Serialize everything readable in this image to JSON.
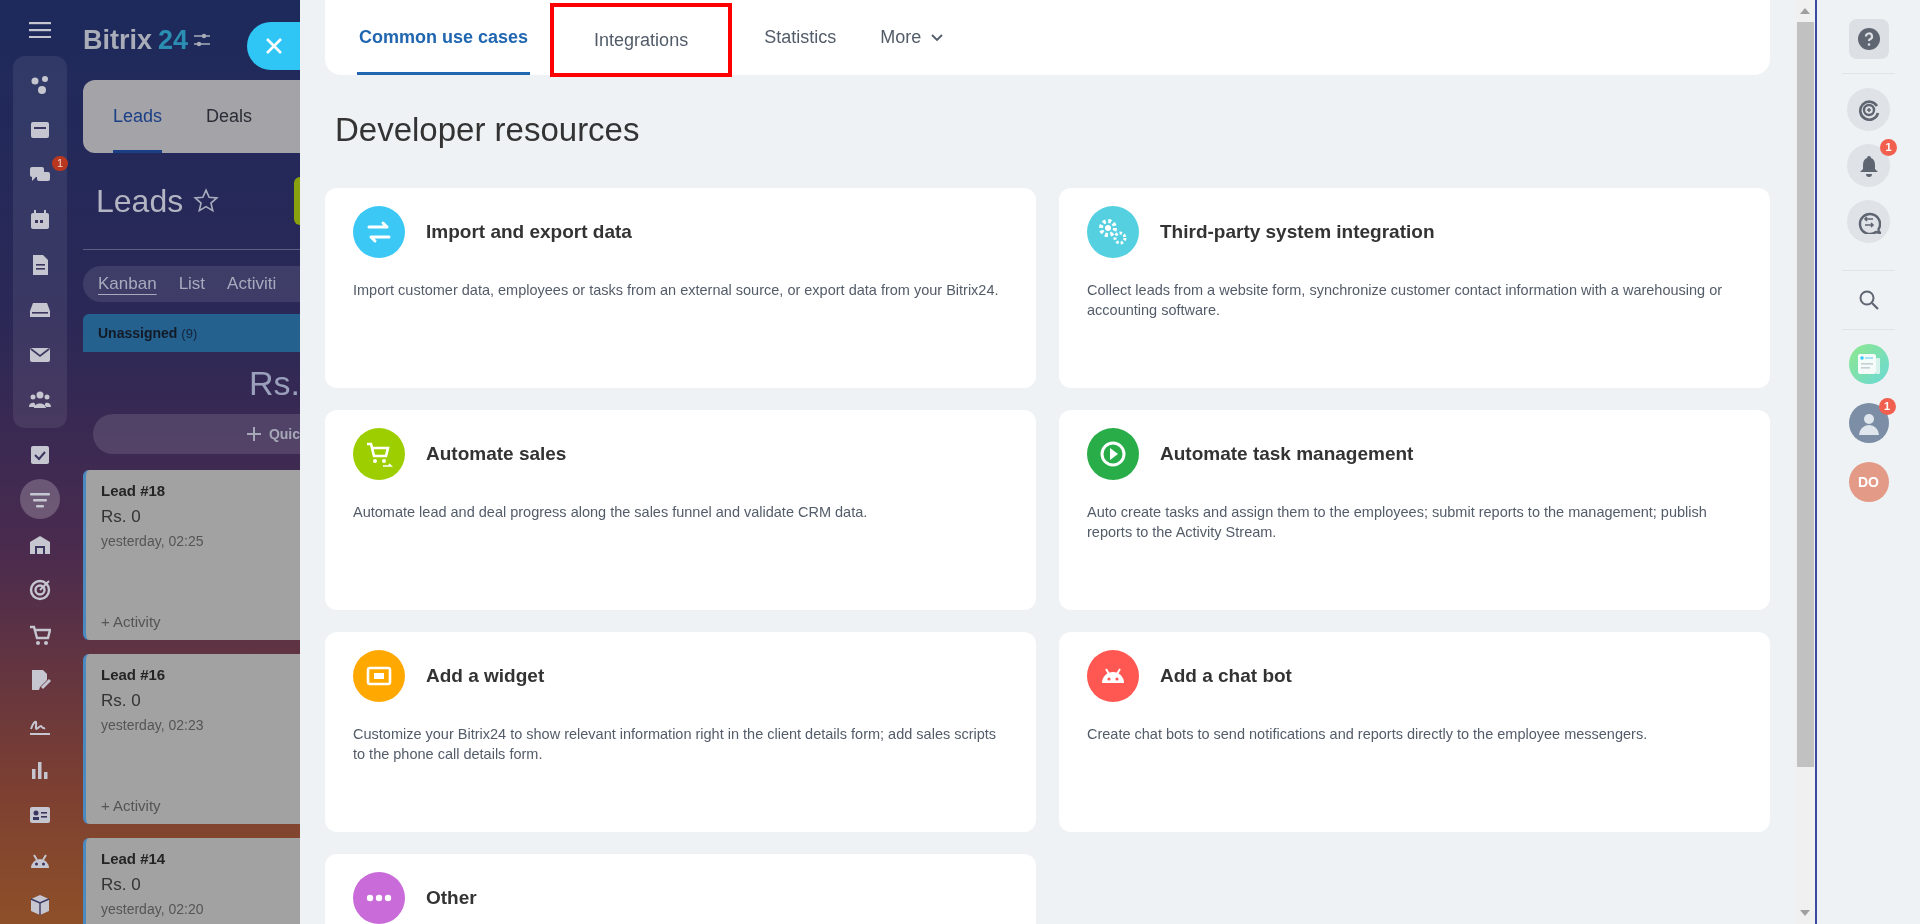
{
  "left_app": {
    "logo": {
      "name": "Bitrix",
      "number": "24"
    },
    "sidebar": {
      "pinned": [
        {
          "selected": false
        },
        {
          "selected": false
        },
        {
          "selected": false,
          "badge": "1"
        },
        {
          "selected": false
        },
        {
          "selected": false
        },
        {
          "selected": false
        },
        {
          "selected": false
        },
        {
          "selected": false
        }
      ],
      "items": [
        {
          "selected": false
        },
        {
          "selected": true
        },
        {
          "selected": false
        },
        {
          "selected": false
        },
        {
          "selected": false
        },
        {
          "selected": false
        },
        {
          "selected": false
        },
        {
          "selected": false
        },
        {
          "selected": false
        },
        {
          "selected": false
        },
        {
          "selected": false
        }
      ]
    },
    "tabs": [
      {
        "label": "Leads",
        "selected": true
      },
      {
        "label": "Deals",
        "selected": false
      }
    ],
    "page_title": "Leads",
    "views": [
      {
        "label": "Kanban",
        "selected": true
      },
      {
        "label": "List",
        "selected": false
      },
      {
        "label": "Activiti",
        "selected": false
      }
    ],
    "column": {
      "title": "Unassigned",
      "count": "(9)",
      "total": "Rs.",
      "quick_add": "Quic"
    },
    "leads": [
      {
        "title": "Lead #18",
        "amount": "Rs. 0",
        "date": "yesterday, 02:25",
        "action": "+ Activity"
      },
      {
        "title": "Lead #16",
        "amount": "Rs. 0",
        "date": "yesterday, 02:23",
        "action": "+ Activity"
      },
      {
        "title": "Lead #14",
        "amount": "Rs. 0",
        "date": "yesterday, 02:20"
      }
    ]
  },
  "panel": {
    "tabs": [
      {
        "label": "Common use cases",
        "selected": true,
        "highlighted": false
      },
      {
        "label": "Integrations",
        "selected": false,
        "highlighted": true
      },
      {
        "label": "Statistics",
        "selected": false,
        "highlighted": false
      },
      {
        "label": "More",
        "selected": false,
        "highlighted": false,
        "dropdown": true
      }
    ],
    "heading": "Developer resources",
    "cards": [
      {
        "title": "Import and export data",
        "description": "Import customer data, employees or tasks from an external source, or export data from your Bitrix24.",
        "color": "#3bc8f5"
      },
      {
        "title": "Third-party system integration",
        "description": "Collect leads from a website form, synchronize customer contact information with a warehousing or accounting software.",
        "color": "#55d0e0"
      },
      {
        "title": "Automate sales",
        "description": "Automate lead and deal progress along the sales funnel and validate CRM data.",
        "color": "#9dcf00"
      },
      {
        "title": "Automate task management",
        "description": "Auto create tasks and assign them to the employees; submit reports to the management; publish reports to the Activity Stream.",
        "color": "#29ad49"
      },
      {
        "title": "Add a widget",
        "description": "Customize your Bitrix24 to show relevant information right in the client details form; add sales scripts to the phone call details form.",
        "color": "#ffa900"
      },
      {
        "title": "Add a chat bot",
        "description": "Create chat bots to send notifications and reports directly to the employee messengers.",
        "color": "#ff5752"
      },
      {
        "title": "Other",
        "color": "#c96bd8"
      }
    ]
  },
  "right_bar": {
    "items": [
      {
        "kind": "help"
      },
      {
        "kind": "divider"
      },
      {
        "kind": "copilot"
      },
      {
        "kind": "bell",
        "badge": "1"
      },
      {
        "kind": "chat"
      },
      {
        "kind": "divider"
      },
      {
        "kind": "search"
      },
      {
        "kind": "divider"
      },
      {
        "kind": "app"
      },
      {
        "kind": "avatar",
        "badge": "1"
      },
      {
        "kind": "initials",
        "text": "DO"
      }
    ]
  }
}
